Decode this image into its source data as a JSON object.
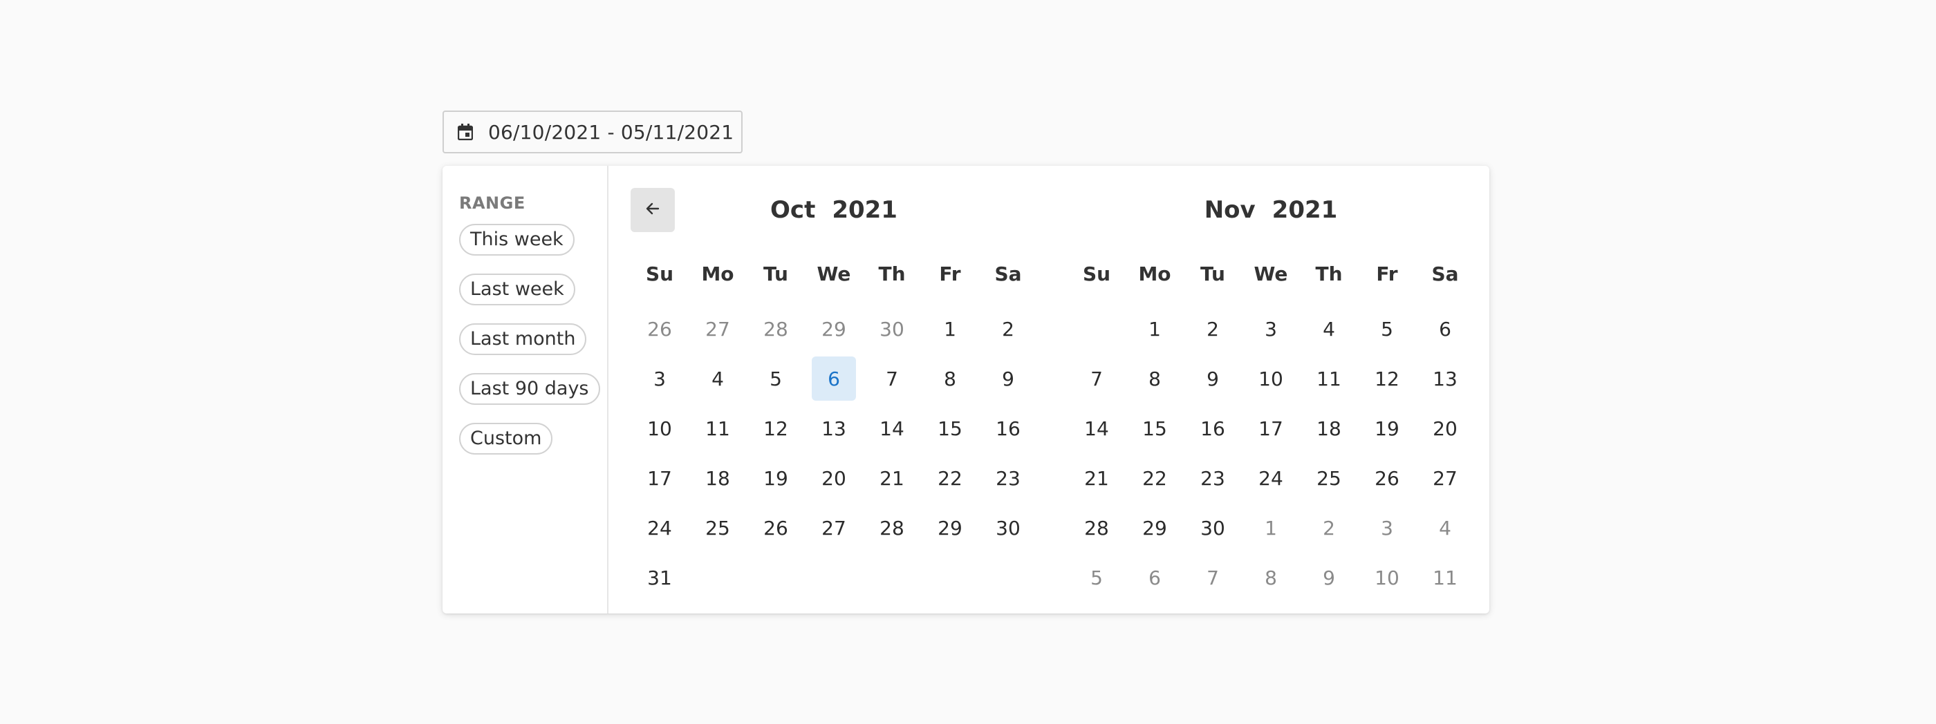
{
  "date_field": {
    "value": "06/10/2021 - 05/11/2021"
  },
  "ranges": {
    "heading": "RANGE",
    "options": [
      "This week",
      "Last week",
      "Last month",
      "Last 90 days",
      "Custom"
    ]
  },
  "weekdays": [
    "Su",
    "Mo",
    "Tu",
    "We",
    "Th",
    "Fr",
    "Sa"
  ],
  "months": [
    {
      "month": "Oct",
      "year": "2021",
      "days": [
        {
          "d": "26",
          "out": true
        },
        {
          "d": "27",
          "out": true
        },
        {
          "d": "28",
          "out": true
        },
        {
          "d": "29",
          "out": true
        },
        {
          "d": "30",
          "out": true
        },
        {
          "d": "1"
        },
        {
          "d": "2"
        },
        {
          "d": "3"
        },
        {
          "d": "4"
        },
        {
          "d": "5"
        },
        {
          "d": "6",
          "selected": true
        },
        {
          "d": "7"
        },
        {
          "d": "8"
        },
        {
          "d": "9"
        },
        {
          "d": "10"
        },
        {
          "d": "11"
        },
        {
          "d": "12"
        },
        {
          "d": "13"
        },
        {
          "d": "14"
        },
        {
          "d": "15"
        },
        {
          "d": "16"
        },
        {
          "d": "17"
        },
        {
          "d": "18"
        },
        {
          "d": "19"
        },
        {
          "d": "20"
        },
        {
          "d": "21"
        },
        {
          "d": "22"
        },
        {
          "d": "23"
        },
        {
          "d": "24"
        },
        {
          "d": "25"
        },
        {
          "d": "26"
        },
        {
          "d": "27"
        },
        {
          "d": "28"
        },
        {
          "d": "29"
        },
        {
          "d": "30"
        },
        {
          "d": "31"
        }
      ]
    },
    {
      "month": "Nov",
      "year": "2021",
      "days": [
        {
          "d": "",
          "blank": true
        },
        {
          "d": "1"
        },
        {
          "d": "2"
        },
        {
          "d": "3"
        },
        {
          "d": "4"
        },
        {
          "d": "5"
        },
        {
          "d": "6"
        },
        {
          "d": "7"
        },
        {
          "d": "8"
        },
        {
          "d": "9"
        },
        {
          "d": "10"
        },
        {
          "d": "11"
        },
        {
          "d": "12"
        },
        {
          "d": "13"
        },
        {
          "d": "14"
        },
        {
          "d": "15"
        },
        {
          "d": "16"
        },
        {
          "d": "17"
        },
        {
          "d": "18"
        },
        {
          "d": "19"
        },
        {
          "d": "20"
        },
        {
          "d": "21"
        },
        {
          "d": "22"
        },
        {
          "d": "23"
        },
        {
          "d": "24"
        },
        {
          "d": "25"
        },
        {
          "d": "26"
        },
        {
          "d": "27"
        },
        {
          "d": "28"
        },
        {
          "d": "29"
        },
        {
          "d": "30"
        },
        {
          "d": "1",
          "out": true
        },
        {
          "d": "2",
          "out": true
        },
        {
          "d": "3",
          "out": true
        },
        {
          "d": "4",
          "out": true
        },
        {
          "d": "5",
          "out": true
        },
        {
          "d": "6",
          "out": true
        },
        {
          "d": "7",
          "out": true
        },
        {
          "d": "8",
          "out": true
        },
        {
          "d": "9",
          "out": true
        },
        {
          "d": "10",
          "out": true
        },
        {
          "d": "11",
          "out": true
        }
      ]
    }
  ],
  "nav": {
    "prev_icon": "arrow-left-icon",
    "next_icon": "arrow-right-icon"
  },
  "colors": {
    "selected_bg": "#dcebf8",
    "selected_text": "#1a73c8",
    "nav_bg": "#e4e4e4",
    "out_of_month_text": "#8a8a8a"
  }
}
